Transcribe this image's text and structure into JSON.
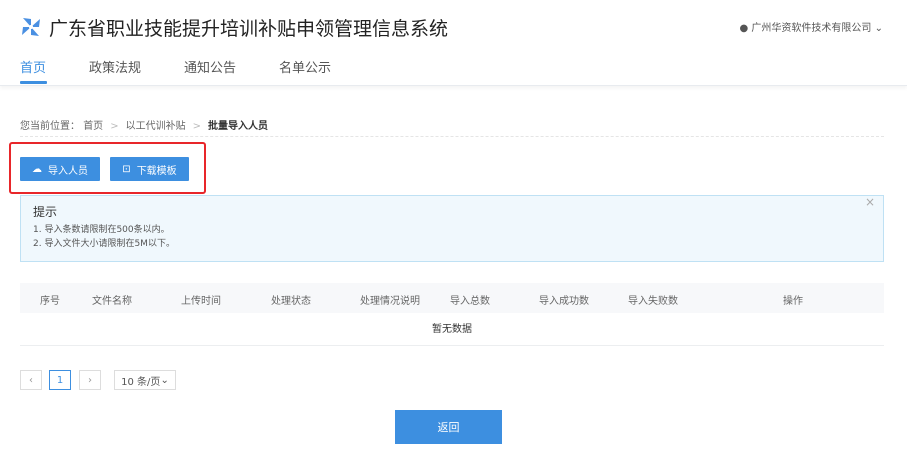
{
  "header": {
    "title": "广东省职业技能提升培训补贴申领管理信息系统",
    "user": "广州华资软件技术有限公司"
  },
  "nav": [
    {
      "label": "首页"
    },
    {
      "label": "政策法规"
    },
    {
      "label": "通知公告"
    },
    {
      "label": "名单公示"
    }
  ],
  "breadcrumb": {
    "prefix": "您当前位置：",
    "items": [
      "首页",
      "以工代训补贴",
      "批量导入人员"
    ],
    "separator": ">"
  },
  "actions": {
    "import": "导入人员",
    "download": "下载模板"
  },
  "alert": {
    "title": "提示",
    "lines": [
      "1. 导入条数请限制在500条以内。",
      "2. 导入文件大小请限制在5M以下。"
    ],
    "close": "×"
  },
  "table": {
    "columns": [
      "序号",
      "文件名称",
      "上传时间",
      "处理状态",
      "处理情况说明",
      "导入总数",
      "导入成功数",
      "导入失败数",
      "操作"
    ],
    "empty": "暂无数据"
  },
  "pagination": {
    "prev": "‹",
    "page": "1",
    "next": "›",
    "size": "10 条/页"
  },
  "footer": {
    "back": "返回"
  },
  "colors": {
    "primary": "#3d8fe0",
    "highlight": "#e8262a"
  }
}
